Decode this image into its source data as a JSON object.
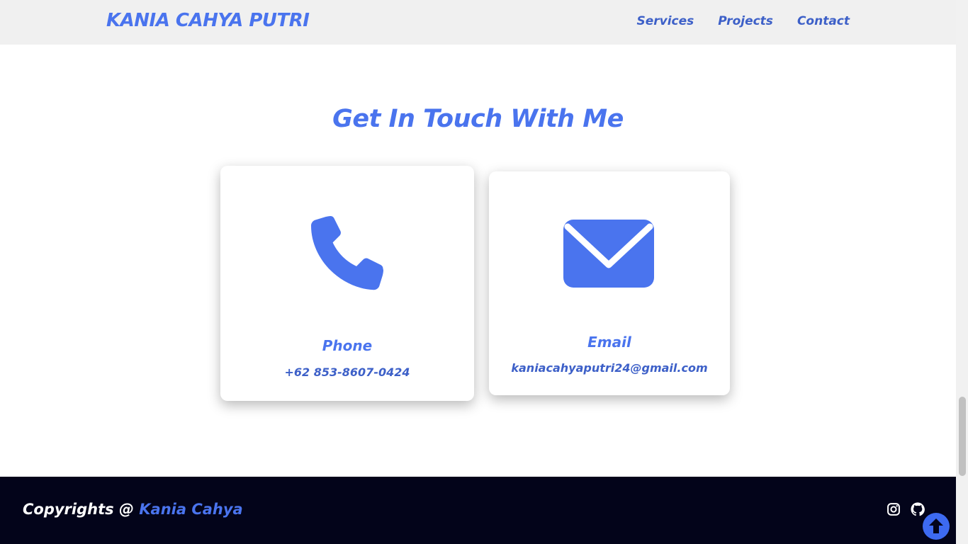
{
  "header": {
    "brand": "KANIA CAHYA PUTRI",
    "nav": [
      "Services",
      "Projects",
      "Contact"
    ]
  },
  "contact": {
    "title": "Get In Touch With Me",
    "phone": {
      "label": "Phone",
      "value": "+62 853-8607-0424",
      "icon": "phone-icon"
    },
    "email": {
      "label": "Email",
      "value": "kaniacahyaputri24@gmail.com",
      "icon": "mail-icon"
    }
  },
  "footer": {
    "copyright_prefix": "Copyrights @ ",
    "copyright_name": "Kania Cahya",
    "social": [
      "instagram-icon",
      "github-icon"
    ]
  },
  "colors": {
    "accent": "#4a74ee",
    "header_bg": "#f0f0f0",
    "footer_bg": "#03041a"
  }
}
